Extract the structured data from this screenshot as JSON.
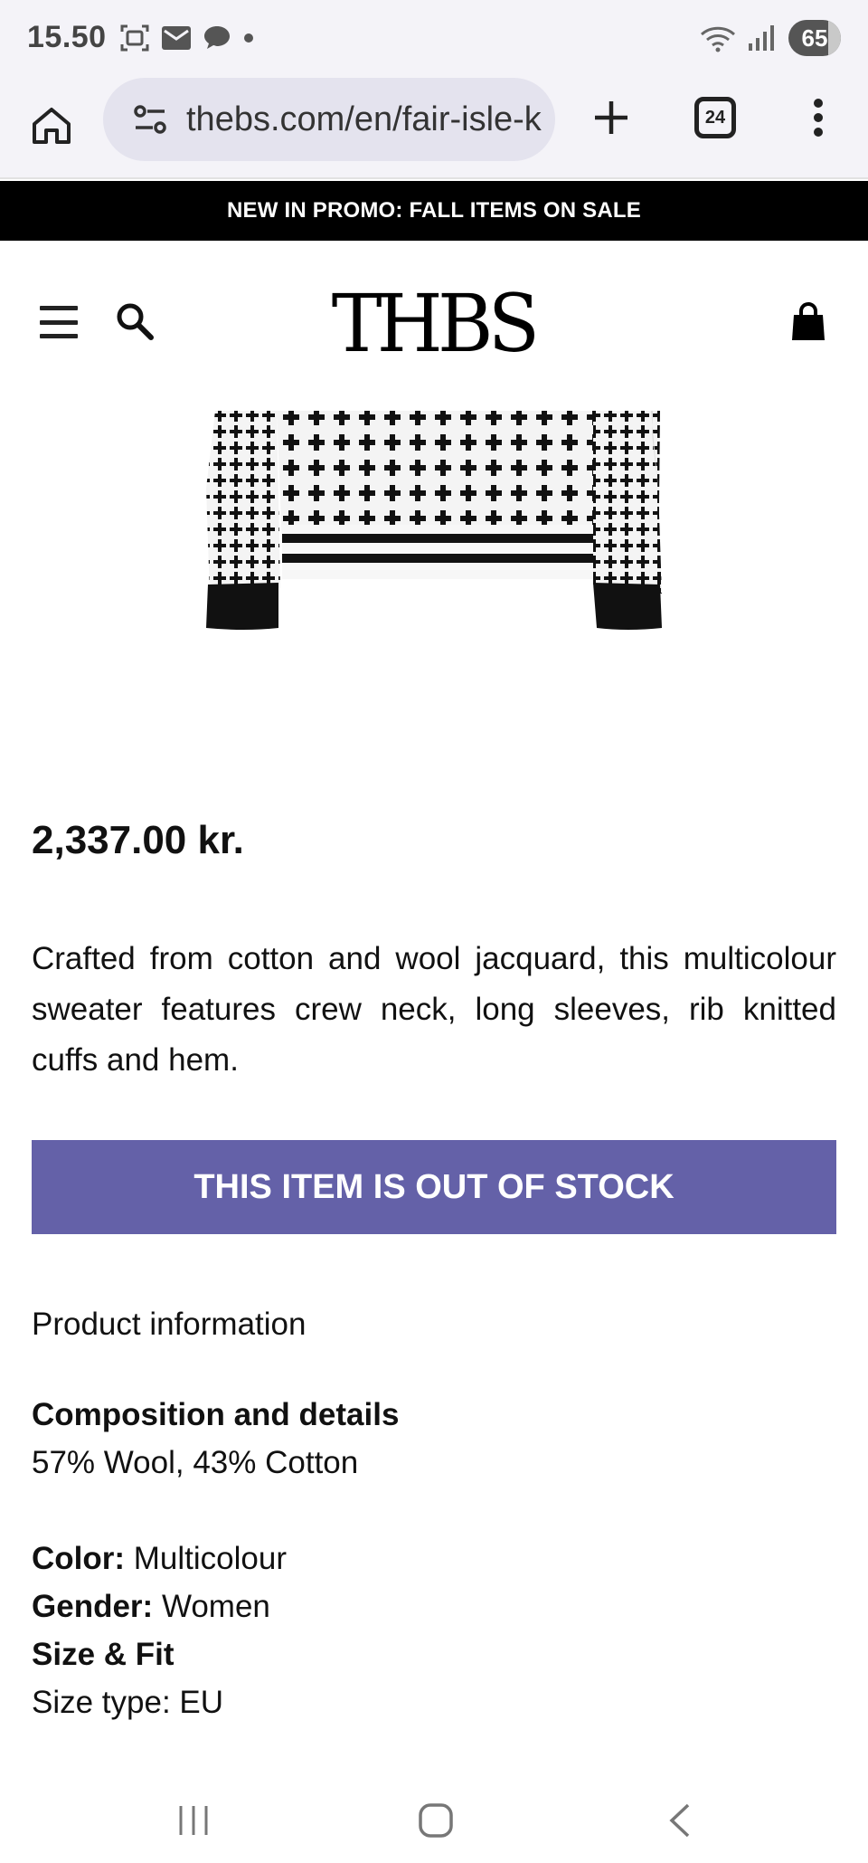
{
  "status_bar": {
    "time": "15.50",
    "battery": "65",
    "icons": [
      "screenshot-icon",
      "mail-icon",
      "chat-icon",
      "dot-icon",
      "wifi-icon",
      "signal-icon",
      "battery-icon"
    ]
  },
  "browser": {
    "url": "thebs.com/en/fair-isle-k",
    "tab_count": "24",
    "icons": [
      "home-icon",
      "site-settings-icon",
      "new-tab-icon",
      "tabs-icon",
      "more-icon"
    ]
  },
  "promo": {
    "text": "NEW IN PROMO: FALL ITEMS ON SALE"
  },
  "header": {
    "logo": "THBS",
    "icons": [
      "menu-icon",
      "search-icon",
      "cart-icon"
    ]
  },
  "product": {
    "price": "2,337.00 kr.",
    "description": "Crafted from cotton and wool jacquard, this multicolour sweater features crew neck, long sleeves, rib knitted cuffs and hem.",
    "stock_button": "THIS ITEM IS OUT OF STOCK",
    "info_heading": "Product information",
    "composition_heading": "Composition and details",
    "composition_value": "57% Wool, 43% Cotton",
    "color_label": "Color:",
    "color_value": "Multicolour",
    "gender_label": "Gender:",
    "gender_value": "Women",
    "size_heading": "Size & Fit",
    "size_type": "Size type: EU"
  },
  "colors": {
    "accent": "#6461a8",
    "promo_bg": "#000000",
    "chrome_bg": "#f4f3f8"
  },
  "nav": {
    "icons": [
      "recent-apps-icon",
      "home-nav-icon",
      "back-icon"
    ]
  }
}
